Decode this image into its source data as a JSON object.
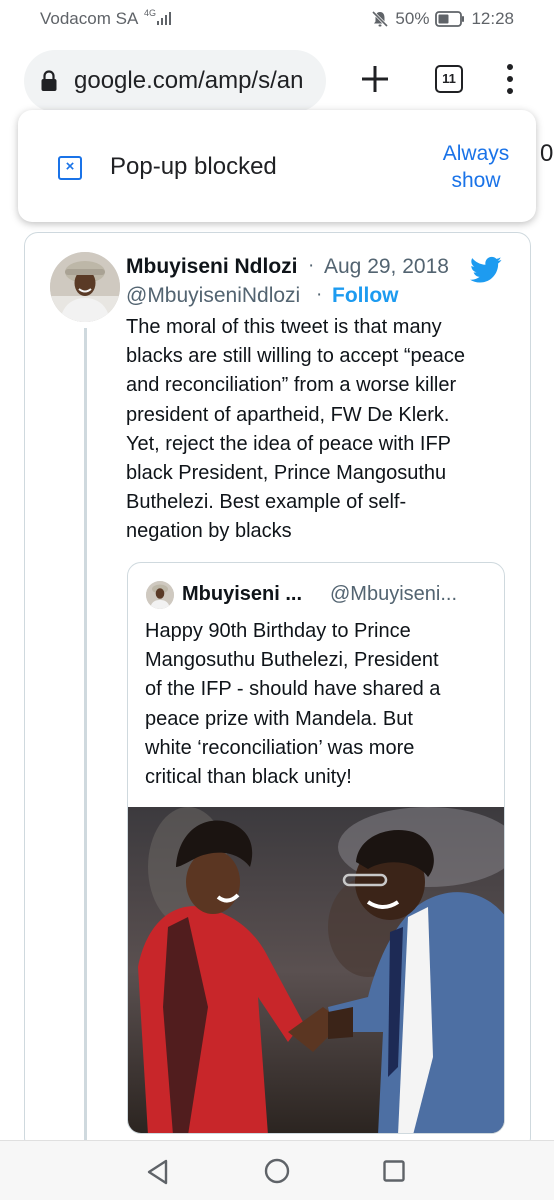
{
  "status_bar": {
    "carrier": "Vodacom SA",
    "network": "4G",
    "battery": "50%",
    "time": "12:28"
  },
  "browser": {
    "url": "google.com/amp/s/an",
    "tab_count": "11",
    "edge_text": "0:"
  },
  "popup": {
    "message": "Pop-up blocked",
    "action_line1": "Always",
    "action_line2": "show"
  },
  "tweet": {
    "author_name": "Mbuyiseni Ndlozi",
    "separator": "·",
    "date": "Aug 29, 2018",
    "handle": "@MbuyiseniNdlozi",
    "follow_label": "Follow",
    "text_lines": [
      "The moral of this tweet is that many",
      "blacks are still willing to accept “peace",
      "and reconciliation” from a worse killer",
      "president of apartheid, FW De Klerk.",
      "Yet, reject the idea of peace with IFP",
      "black President, Prince Mangosuthu",
      "Buthelezi. Best example of self-",
      "negation by blacks"
    ]
  },
  "quoted_tweet": {
    "author_name": "Mbuyiseni ...",
    "handle": "@Mbuyiseni...",
    "text_lines": [
      "Happy 90th Birthday to Prince",
      "Mangosuthu Buthelezi, President",
      "of the IFP - should have shared a",
      "peace prize with Mandela. But",
      "white ‘reconciliation’ was more",
      "critical than black unity!"
    ]
  },
  "icons": {
    "twitter": "twitter-bird-icon",
    "lock": "lock-icon",
    "popup": "popup-blocked-icon",
    "back": "back-triangle-icon",
    "home": "home-circle-icon",
    "recents": "recents-square-icon"
  },
  "colors": {
    "link_blue": "#1a73e8",
    "twitter_blue": "#1d9bf0",
    "text_secondary": "#536471"
  }
}
